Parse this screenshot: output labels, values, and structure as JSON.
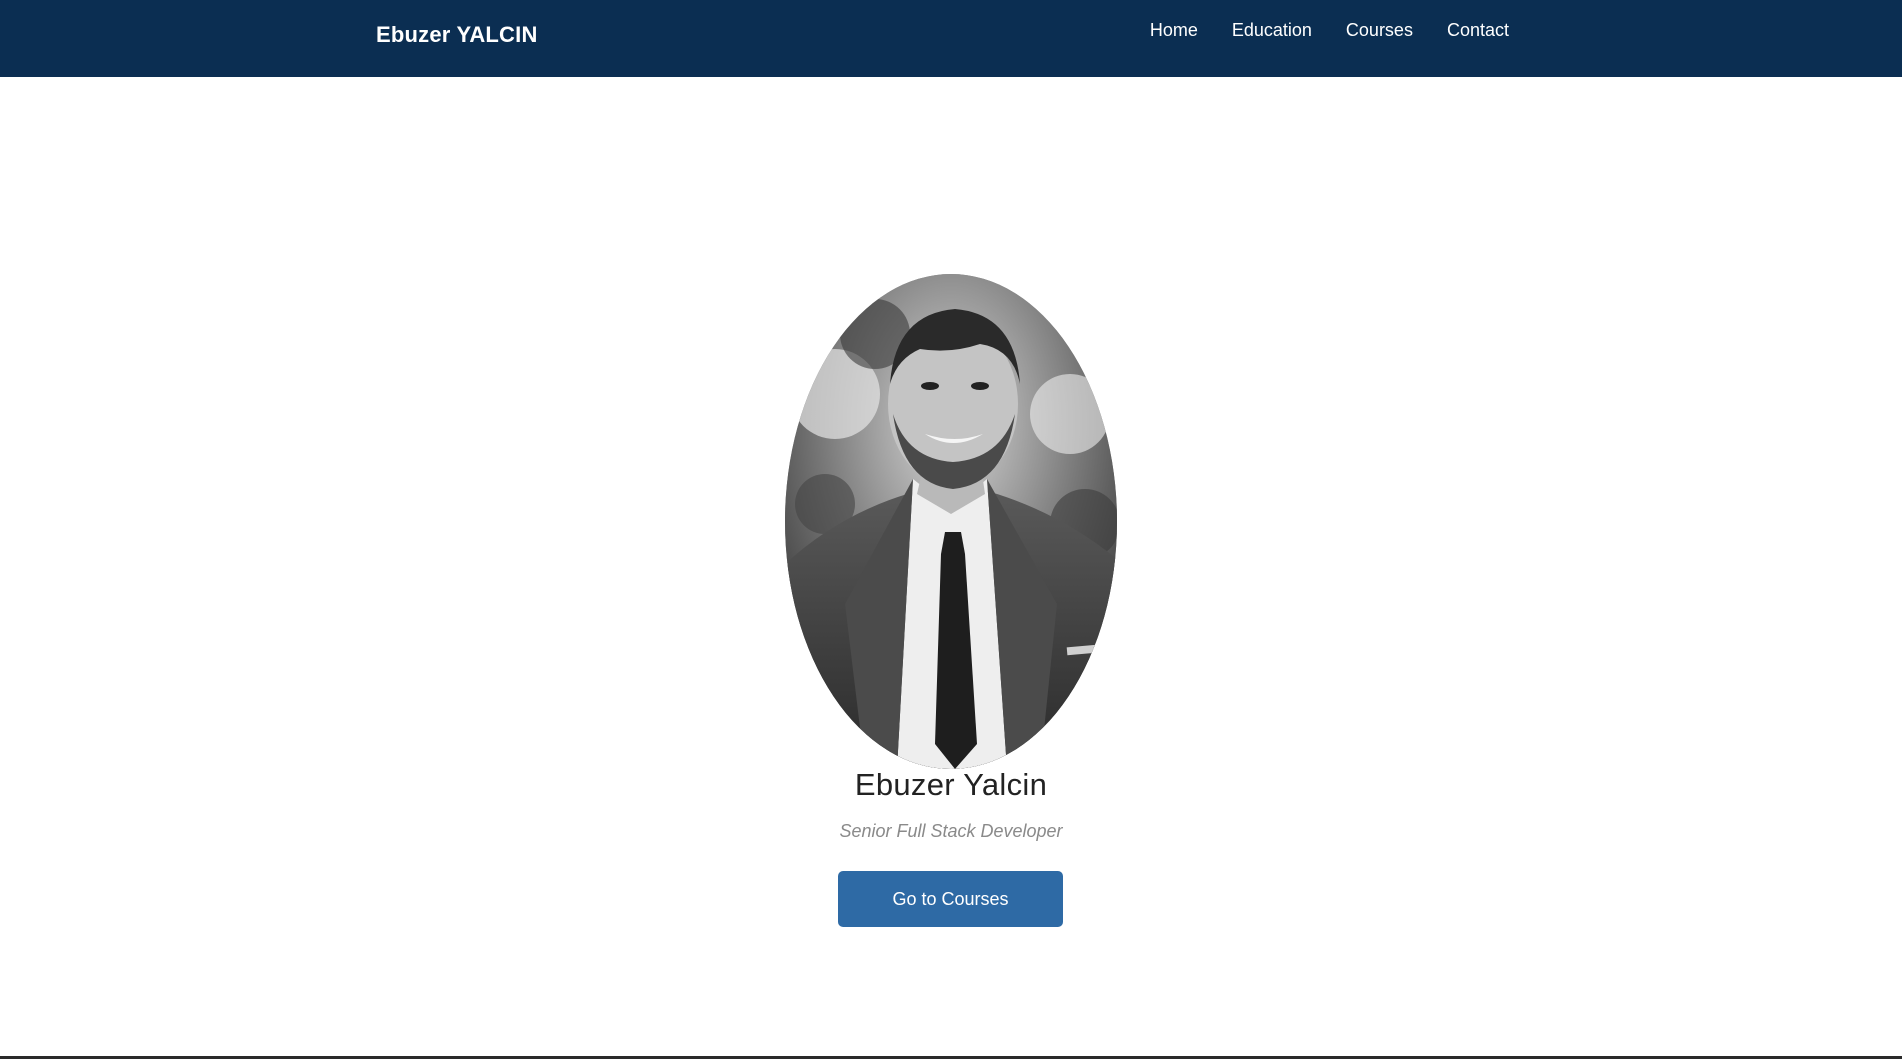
{
  "navbar": {
    "brand": "Ebuzer YALCIN",
    "links": [
      {
        "label": "Home"
      },
      {
        "label": "Education"
      },
      {
        "label": "Courses"
      },
      {
        "label": "Contact"
      }
    ],
    "background": "#0b2e52"
  },
  "hero": {
    "name": "Ebuzer Yalcin",
    "role": "Senior Full Stack Developer",
    "cta_label": "Go to Courses",
    "cta_color": "#2e6aa5"
  }
}
